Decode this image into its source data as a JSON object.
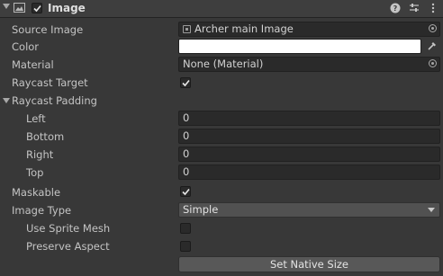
{
  "component": {
    "title": "Image",
    "enabled": true,
    "icons": [
      "image-component-icon",
      "help-icon",
      "presets-icon",
      "kebab-menu-icon"
    ]
  },
  "properties": {
    "source_image": {
      "label": "Source Image",
      "value": "Archer main Image"
    },
    "color": {
      "label": "Color",
      "value": "#ffffff"
    },
    "material": {
      "label": "Material",
      "value": "None (Material)"
    },
    "raycast_target": {
      "label": "Raycast Target",
      "checked": true
    },
    "raycast_padding": {
      "label": "Raycast Padding",
      "expanded": true,
      "left": {
        "label": "Left",
        "value": "0"
      },
      "bottom": {
        "label": "Bottom",
        "value": "0"
      },
      "right": {
        "label": "Right",
        "value": "0"
      },
      "top": {
        "label": "Top",
        "value": "0"
      }
    },
    "maskable": {
      "label": "Maskable",
      "checked": true
    },
    "image_type": {
      "label": "Image Type",
      "value": "Simple"
    },
    "use_sprite_mesh": {
      "label": "Use Sprite Mesh",
      "checked": false
    },
    "preserve_aspect": {
      "label": "Preserve Aspect",
      "checked": false
    }
  },
  "actions": {
    "set_native_size": "Set Native Size"
  }
}
